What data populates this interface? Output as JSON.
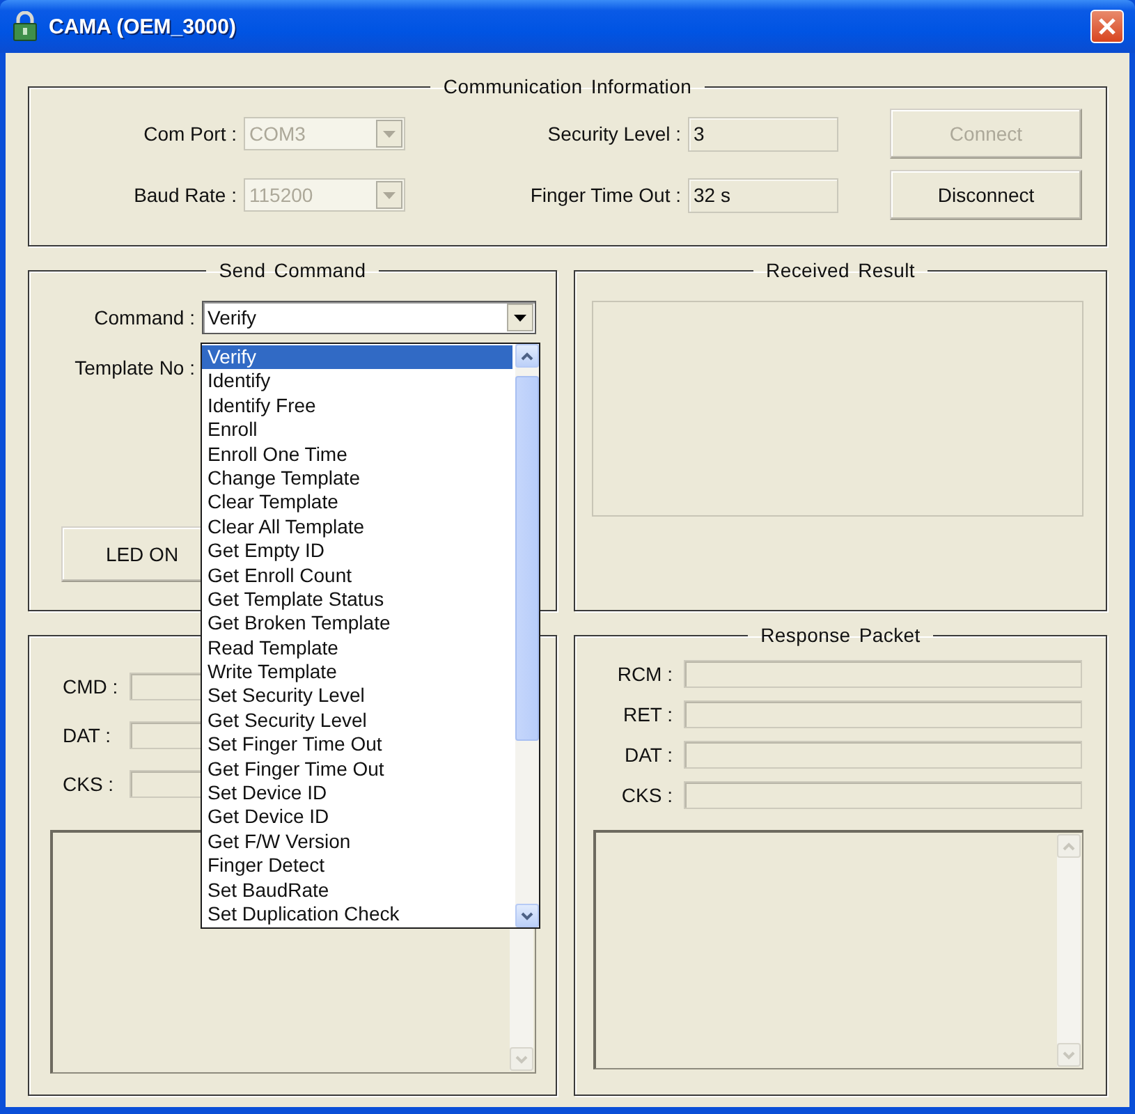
{
  "window": {
    "title": "CAMA (OEM_3000)"
  },
  "communication": {
    "title": "Communication  Information",
    "fields": [
      {
        "label": "Com Port :",
        "value": "COM3",
        "kind": "combo",
        "disabled": true
      },
      {
        "label": "Security Level :",
        "value": "3",
        "kind": "text"
      },
      {
        "label": "Baud Rate :",
        "value": "115200",
        "kind": "combo",
        "disabled": true
      },
      {
        "label": "Finger Time Out :",
        "value": "32 s",
        "kind": "text"
      }
    ],
    "buttons": [
      {
        "label": "Connect",
        "disabled": true
      },
      {
        "label": "Disconnect",
        "disabled": false
      }
    ]
  },
  "send_command": {
    "title": "Send Command",
    "command": {
      "label": "Command :",
      "value": "Verify",
      "expanded": true,
      "options": [
        {
          "label": "Verify",
          "selected": true
        },
        {
          "label": "Identify",
          "selected": false
        },
        {
          "label": "Identify Free",
          "selected": false
        },
        {
          "label": "Enroll",
          "selected": false
        },
        {
          "label": "Enroll One Time",
          "selected": false
        },
        {
          "label": "Change Template",
          "selected": false
        },
        {
          "label": "Clear Template",
          "selected": false
        },
        {
          "label": "Clear All Template",
          "selected": false
        },
        {
          "label": "Get Empty ID",
          "selected": false
        },
        {
          "label": "Get Enroll Count",
          "selected": false
        },
        {
          "label": "Get Template Status",
          "selected": false
        },
        {
          "label": "Get Broken Template",
          "selected": false
        },
        {
          "label": "Read Template",
          "selected": false
        },
        {
          "label": "Write Template",
          "selected": false
        },
        {
          "label": "Set Security Level",
          "selected": false
        },
        {
          "label": "Get Security Level",
          "selected": false
        },
        {
          "label": "Set Finger Time Out",
          "selected": false
        },
        {
          "label": "Get Finger Time Out",
          "selected": false
        },
        {
          "label": "Set Device ID",
          "selected": false
        },
        {
          "label": "Get Device ID",
          "selected": false
        },
        {
          "label": "Get F/W Version",
          "selected": false
        },
        {
          "label": "Finger Detect",
          "selected": false
        },
        {
          "label": "Set BaudRate",
          "selected": false
        },
        {
          "label": "Set Duplication Check",
          "selected": false
        }
      ]
    },
    "template_no": {
      "label": "Template No :"
    },
    "led_button": {
      "label": "LED ON"
    }
  },
  "received_result": {
    "title": "Received Result"
  },
  "command_packet": {
    "fields": [
      {
        "label": "CMD :"
      },
      {
        "label": "DAT :"
      },
      {
        "label": "CKS :"
      }
    ]
  },
  "response_packet": {
    "title": "Response Packet",
    "fields": [
      {
        "label": "RCM :"
      },
      {
        "label": "RET :"
      },
      {
        "label": "DAT :"
      },
      {
        "label": "CKS :"
      }
    ]
  }
}
